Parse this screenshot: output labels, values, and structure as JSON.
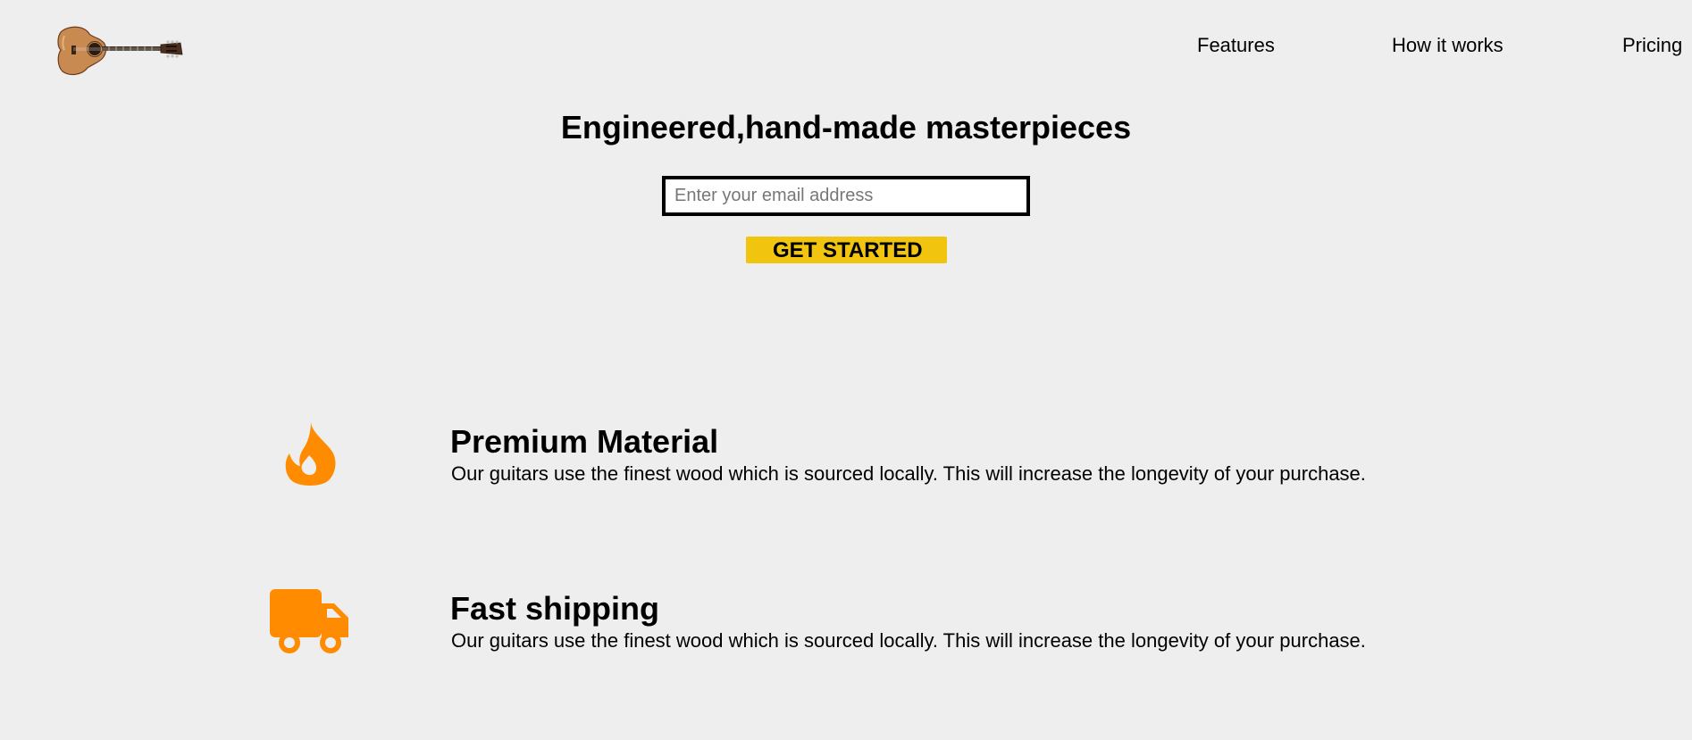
{
  "header": {
    "logo_icon": "guitar-icon",
    "nav": [
      {
        "label": "Features"
      },
      {
        "label": "How it works"
      },
      {
        "label": "Pricing"
      }
    ]
  },
  "hero": {
    "title": "Engineered,hand-made masterpieces",
    "email_placeholder": "Enter your email address",
    "email_value": "",
    "cta_label": "GET STARTED"
  },
  "features": [
    {
      "icon": "fire-icon",
      "title": "Premium Material",
      "description": "Our guitars use the finest wood which is sourced locally. This will increase the longevity of your purchase."
    },
    {
      "icon": "truck-icon",
      "title": "Fast shipping",
      "description": "Our guitars use the finest wood which is sourced locally. This will increase the longevity of your purchase."
    }
  ],
  "colors": {
    "background": "#eeeeee",
    "accent_icon": "#ff8c00",
    "cta_background": "#f1c40f"
  }
}
